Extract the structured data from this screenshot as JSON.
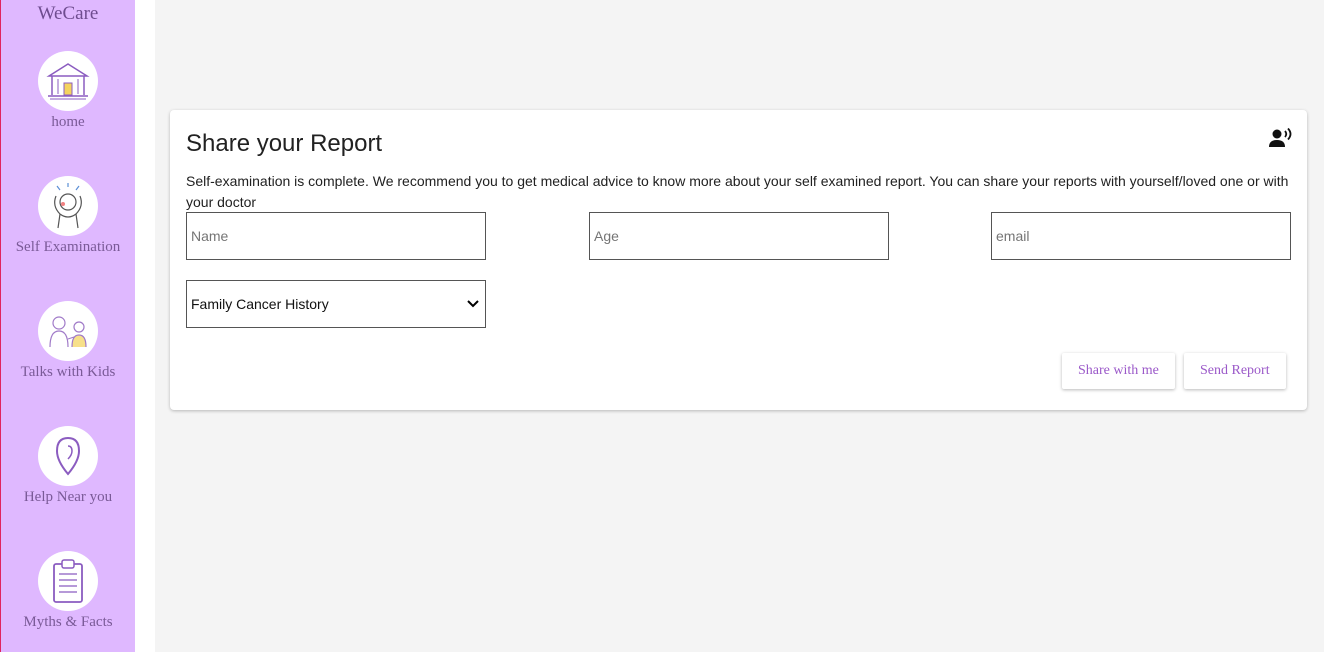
{
  "sidebar": {
    "brand": "WeCare",
    "items": [
      {
        "label": "home",
        "icon": "home-icon"
      },
      {
        "label": "Self Examination",
        "icon": "self-examination-icon"
      },
      {
        "label": "Talks with Kids",
        "icon": "talks-with-kids-icon"
      },
      {
        "label": "Help Near you",
        "icon": "location-pin-icon"
      },
      {
        "label": "Myths & Facts",
        "icon": "clipboard-icon"
      }
    ]
  },
  "report": {
    "title": "Share your Report",
    "description": "Self-examination is complete. We recommend you to get medical advice to know more about your self examined report. You can share your reports with yourself/loved one or with your doctor",
    "name_placeholder": "Name",
    "age_placeholder": "Age",
    "email_placeholder": "email",
    "history_selected": "Family Cancer History",
    "share_with_me_label": "Share with me",
    "send_report_label": "Send Report"
  },
  "colors": {
    "sidebar_bg": "#dfb8ff",
    "accent": "#9b59c9",
    "page_bg": "#f4f4f4"
  }
}
